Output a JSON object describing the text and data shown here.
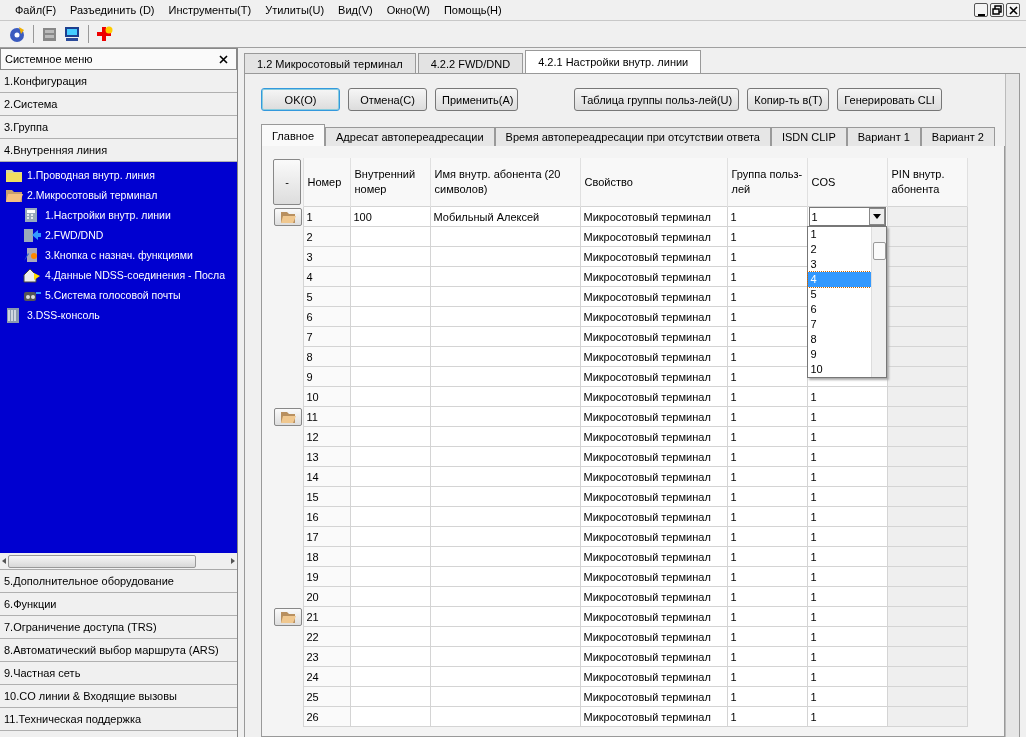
{
  "menu_bar": [
    "Файл(F)",
    "Разъединить (D)",
    "Инструменты(T)",
    "Утилиты(U)",
    "Вид(V)",
    "Окно(W)",
    "Помощь(H)"
  ],
  "toolbar": [
    {
      "kind": "disc"
    },
    {
      "kind": "sep"
    },
    {
      "kind": "cabinet"
    },
    {
      "kind": "computer"
    },
    {
      "kind": "sep"
    },
    {
      "kind": "help"
    }
  ],
  "sidebar": {
    "title": "Системное меню",
    "sections": [
      {
        "label": "1.Конфигурация"
      },
      {
        "label": "2.Система"
      },
      {
        "label": "3.Группа"
      },
      {
        "label": "4.Внутренняя линия",
        "children": [
          {
            "label": "1.Проводная внутр. линия",
            "kind": "folder",
            "expanded": false
          },
          {
            "label": "2.Микросотовый терминал",
            "kind": "folder",
            "expanded": true,
            "children": [
              {
                "label": "1.Настройки внутр. линии",
                "kind": "phone"
              },
              {
                "label": "2.FWD/DND",
                "kind": "forward"
              },
              {
                "label": "3.Кнопка с назнач. функциями",
                "kind": "keys"
              },
              {
                "label": "4.Данные NDSS-соединения - Посла",
                "kind": "house"
              },
              {
                "label": "5.Система голосовой почты",
                "kind": "voicemail"
              }
            ]
          },
          {
            "label": "3.DSS-консоль",
            "kind": "console"
          }
        ]
      },
      {
        "label": "5.Дополнительное оборудование"
      },
      {
        "label": "6.Функции"
      },
      {
        "label": "7.Ограничение доступа (TRS)"
      },
      {
        "label": "8.Автоматический выбор маршрута (ARS)"
      },
      {
        "label": "9.Частная сеть"
      },
      {
        "label": "10.CO линии & Входящие вызовы"
      },
      {
        "label": "11.Техническая поддержка"
      }
    ]
  },
  "doc_tabs": [
    {
      "label": "1.2 Микросотовый терминал",
      "selected": false
    },
    {
      "label": "4.2.2 FWD/DND",
      "selected": false
    },
    {
      "label": "4.2.1 Настройки внутр. линии",
      "selected": true
    }
  ],
  "buttons_left": [
    {
      "label": "OK(O)",
      "focused": true
    },
    {
      "label": "Отмена(C)",
      "focused": false
    },
    {
      "label": "Применить(A)",
      "focused": false
    }
  ],
  "buttons_right": [
    "Таблица группы польз-лей(U)",
    "Копир-ть в(T)",
    "Генерировать CLI"
  ],
  "tabs": [
    {
      "label": "Главное",
      "selected": true
    },
    {
      "label": "Адресат автопереадресации",
      "selected": false
    },
    {
      "label": "Время автопереадресации при отсутствии ответа",
      "selected": false
    },
    {
      "label": "ISDN CLIP",
      "selected": false
    },
    {
      "label": "Вариант 1",
      "selected": false
    },
    {
      "label": "Вариант 2",
      "selected": false
    }
  ],
  "table": {
    "corner_button": "-",
    "columns": [
      "Номер",
      "Внутренний номер",
      "Имя внутр. абонента (20 символов)",
      "Свойство",
      "Группа польз-лей",
      "COS",
      "PIN внутр. абонента"
    ],
    "rows": [
      {
        "row_button": true,
        "number": "1",
        "extension": "100",
        "name": "Мобильный Алексей",
        "property": "Микросотовый терминал",
        "group": "1",
        "cos": "1",
        "cos_dropdown": {
          "options": [
            {
              "label": "1",
              "selected": false
            },
            {
              "label": "2",
              "selected": false
            },
            {
              "label": "3",
              "selected": false
            },
            {
              "label": "4",
              "selected": true
            },
            {
              "label": "5",
              "selected": false
            },
            {
              "label": "6",
              "selected": false
            },
            {
              "label": "7",
              "selected": false
            },
            {
              "label": "8",
              "selected": false
            },
            {
              "label": "9",
              "selected": false
            },
            {
              "label": "10",
              "selected": false
            }
          ]
        }
      },
      {
        "row_button": false,
        "number": "2",
        "property": "Микросотовый терминал",
        "group": "1"
      },
      {
        "row_button": false,
        "number": "3",
        "property": "Микросотовый терминал",
        "group": "1"
      },
      {
        "row_button": false,
        "number": "4",
        "property": "Микросотовый терминал",
        "group": "1"
      },
      {
        "row_button": false,
        "number": "5",
        "property": "Микросотовый терминал",
        "group": "1"
      },
      {
        "row_button": false,
        "number": "6",
        "property": "Микросотовый терминал",
        "group": "1"
      },
      {
        "row_button": false,
        "number": "7",
        "property": "Микросотовый терминал",
        "group": "1"
      },
      {
        "row_button": false,
        "number": "8",
        "property": "Микросотовый терминал",
        "group": "1"
      },
      {
        "row_button": false,
        "number": "9",
        "property": "Микросотовый терминал",
        "group": "1"
      },
      {
        "row_button": false,
        "number": "10",
        "property": "Микросотовый терминал",
        "group": "1",
        "cos": "1"
      },
      {
        "row_button": true,
        "number": "11",
        "property": "Микросотовый терминал",
        "group": "1",
        "cos": "1"
      },
      {
        "row_button": false,
        "number": "12",
        "property": "Микросотовый терминал",
        "group": "1",
        "cos": "1"
      },
      {
        "row_button": false,
        "number": "13",
        "property": "Микросотовый терминал",
        "group": "1",
        "cos": "1"
      },
      {
        "row_button": false,
        "number": "14",
        "property": "Микросотовый терминал",
        "group": "1",
        "cos": "1"
      },
      {
        "row_button": false,
        "number": "15",
        "property": "Микросотовый терминал",
        "group": "1",
        "cos": "1"
      },
      {
        "row_button": false,
        "number": "16",
        "property": "Микросотовый терминал",
        "group": "1",
        "cos": "1"
      },
      {
        "row_button": false,
        "number": "17",
        "property": "Микросотовый терминал",
        "group": "1",
        "cos": "1"
      },
      {
        "row_button": false,
        "number": "18",
        "property": "Микросотовый терминал",
        "group": "1",
        "cos": "1"
      },
      {
        "row_button": false,
        "number": "19",
        "property": "Микросотовый терминал",
        "group": "1",
        "cos": "1"
      },
      {
        "row_button": false,
        "number": "20",
        "property": "Микросотовый терминал",
        "group": "1",
        "cos": "1"
      },
      {
        "row_button": true,
        "number": "21",
        "property": "Микросотовый терминал",
        "group": "1",
        "cos": "1"
      },
      {
        "row_button": false,
        "number": "22",
        "property": "Микросотовый терминал",
        "group": "1",
        "cos": "1"
      },
      {
        "row_button": false,
        "number": "23",
        "property": "Микросотовый терминал",
        "group": "1",
        "cos": "1"
      },
      {
        "row_button": false,
        "number": "24",
        "property": "Микросотовый терминал",
        "group": "1",
        "cos": "1"
      },
      {
        "row_button": false,
        "number": "25",
        "property": "Микросотовый терминал",
        "group": "1",
        "cos": "1"
      },
      {
        "row_button": false,
        "number": "26",
        "property": "Микросотовый терминал",
        "group": "1",
        "cos": "1"
      }
    ]
  }
}
